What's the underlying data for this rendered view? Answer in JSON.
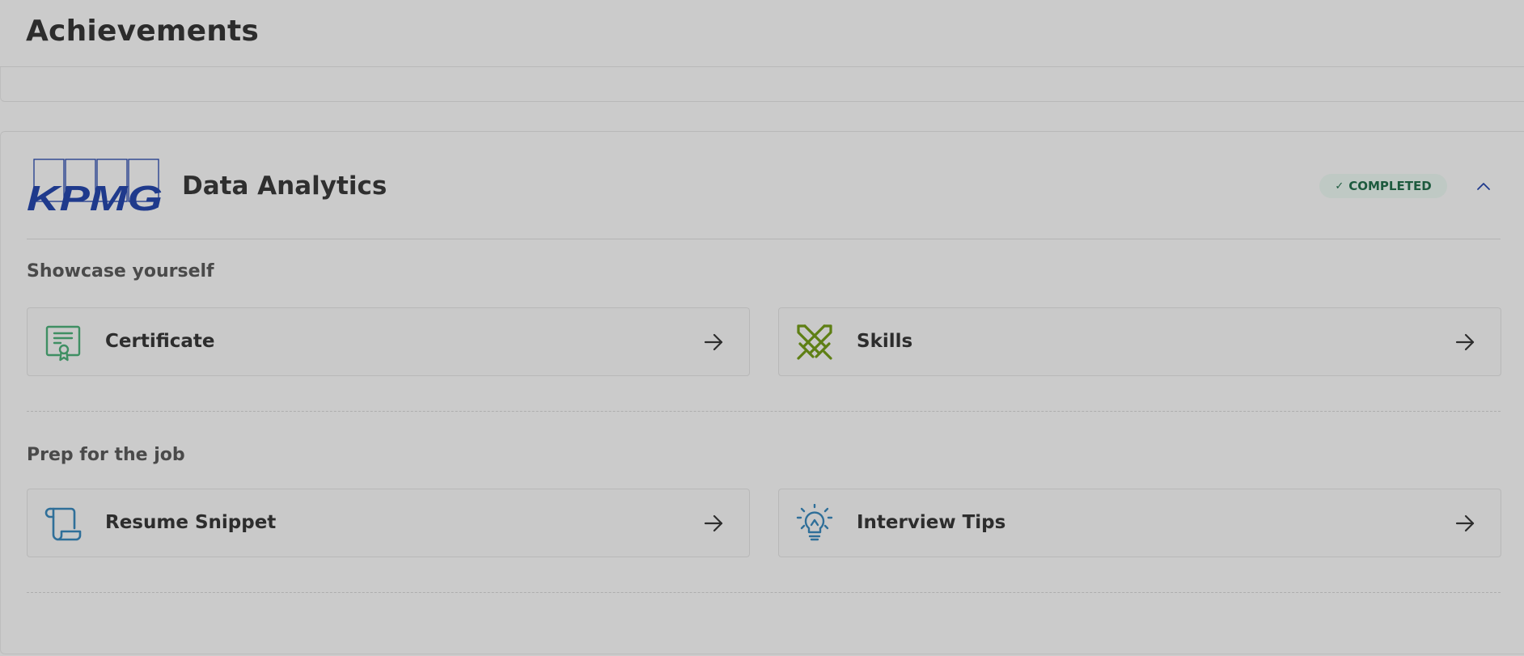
{
  "page": {
    "title": "Achievements"
  },
  "course": {
    "company": "KPMG",
    "title": "Data Analytics",
    "status": "COMPLETED",
    "status_color": "#1d5a3e",
    "sections": [
      {
        "heading": "Showcase yourself",
        "tiles": [
          {
            "label": "Certificate",
            "icon": "certificate-icon",
            "icon_color": "#3f8f63"
          },
          {
            "label": "Skills",
            "icon": "crossed-swords-icon",
            "icon_color": "#5e7f14"
          }
        ]
      },
      {
        "heading": "Prep for the job",
        "tiles": [
          {
            "label": "Resume Snippet",
            "icon": "scroll-icon",
            "icon_color": "#2f6f99"
          },
          {
            "label": "Interview Tips",
            "icon": "lightbulb-icon",
            "icon_color": "#2f6f99"
          }
        ]
      }
    ]
  },
  "colors": {
    "background": "#cbcbcb",
    "kpmg_blue": "#1f3a8c"
  }
}
